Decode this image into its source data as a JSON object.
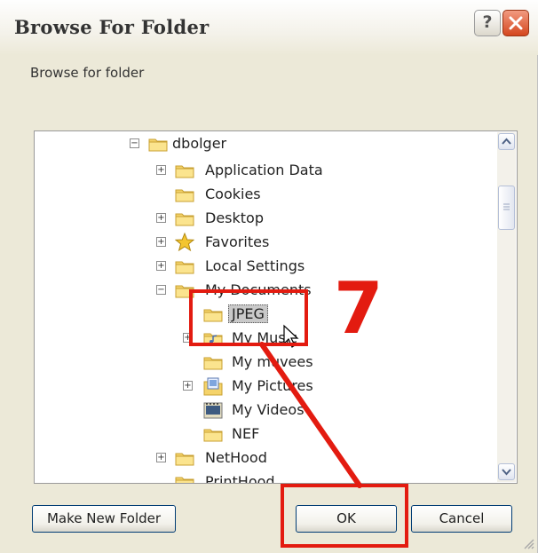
{
  "window": {
    "title": "Browse For Folder",
    "help_glyph": "?",
    "close_icon": "close-icon",
    "accent": "#d4461e"
  },
  "prompt": "Browse for folder",
  "tree": {
    "nodes": [
      {
        "label": "dbolger",
        "expander": "−",
        "icon": "folder-icon"
      },
      {
        "label": "Application Data",
        "expander": "+",
        "icon": "folder-icon"
      },
      {
        "label": "Cookies",
        "expander": "",
        "icon": "folder-icon"
      },
      {
        "label": "Desktop",
        "expander": "+",
        "icon": "folder-icon"
      },
      {
        "label": "Favorites",
        "expander": "+",
        "icon": "star-icon"
      },
      {
        "label": "Local Settings",
        "expander": "+",
        "icon": "folder-icon"
      },
      {
        "label": "My Documents",
        "expander": "−",
        "icon": "folder-icon"
      },
      {
        "label": "JPEG",
        "expander": "",
        "icon": "folder-icon",
        "selected": true
      },
      {
        "label": "My Music",
        "expander": "+",
        "icon": "music-folder-icon"
      },
      {
        "label": "My muvees",
        "expander": "",
        "icon": "folder-icon"
      },
      {
        "label": "My Pictures",
        "expander": "+",
        "icon": "pictures-folder-icon"
      },
      {
        "label": "My Videos",
        "expander": "",
        "icon": "videos-folder-icon"
      },
      {
        "label": "NEF",
        "expander": "",
        "icon": "folder-icon"
      },
      {
        "label": "NetHood",
        "expander": "+",
        "icon": "folder-icon"
      },
      {
        "label": "PrintHood",
        "expander": "",
        "icon": "folder-icon"
      }
    ]
  },
  "buttons": {
    "make_new_folder": "Make New Folder",
    "ok": "OK",
    "cancel": "Cancel"
  },
  "annotation": {
    "step_number": "7",
    "color": "#e31b10"
  }
}
